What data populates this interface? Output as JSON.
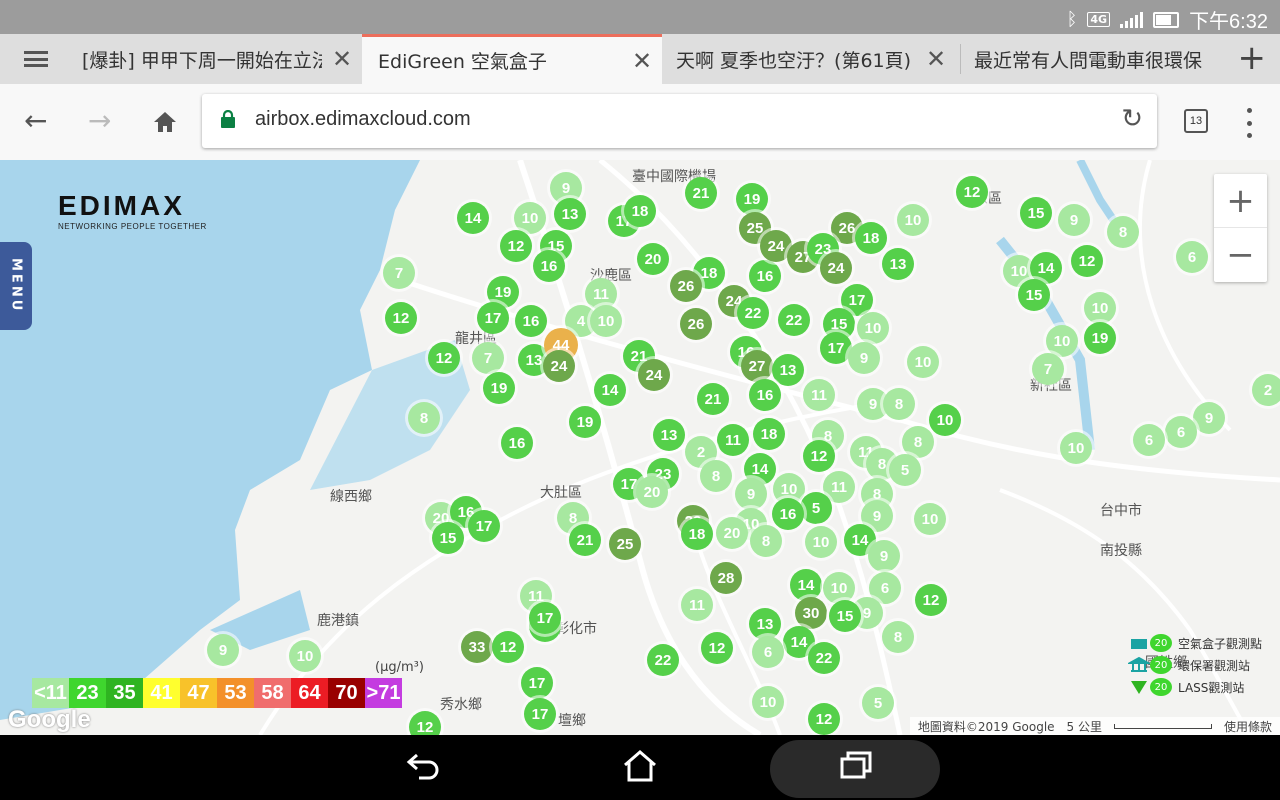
{
  "status": {
    "network": "4G",
    "time": "下午6:32"
  },
  "tabs": [
    {
      "title": "[爆卦] 甲甲下周一開始在立法",
      "active": false
    },
    {
      "title": "EdiGreen 空氣盒子",
      "active": true
    },
    {
      "title": "天啊 夏季也空汙？(第61頁)",
      "active": false
    },
    {
      "title": "最近常有人問電動車很環保",
      "active": false
    }
  ],
  "toolbar": {
    "url": "airbox.edimaxcloud.com",
    "tab_count": "13"
  },
  "map": {
    "brand": {
      "wordmark": "EDIMAX",
      "tagline": "NETWORKING PEOPLE TOGETHER"
    },
    "menu_label": "MENU",
    "zoom_in": "+",
    "zoom_out": "−",
    "places": [
      "臺中國際機場",
      "沙鹿區",
      "龍井區",
      "大肚區",
      "線西鄉",
      "鹿港鎮",
      "彰化市",
      "秀水鄉",
      "壇鄉",
      "南投縣",
      "台中市",
      "國姓鄉",
      "豐原區",
      "新社區"
    ],
    "legend": {
      "unit": "(μg/m³)",
      "bins": [
        {
          "label": "<11",
          "color": "#a7e8a0"
        },
        {
          "label": "23",
          "color": "#3fd62e"
        },
        {
          "label": "35",
          "color": "#2fb421"
        },
        {
          "label": "41",
          "color": "#ffff2e"
        },
        {
          "label": "47",
          "color": "#f8c22a"
        },
        {
          "label": "53",
          "color": "#f3902a"
        },
        {
          "label": "58",
          "color": "#f06d6d"
        },
        {
          "label": "64",
          "color": "#ec1c24"
        },
        {
          "label": "70",
          "color": "#990000"
        },
        {
          "label": ">71",
          "color": "#c43ce0"
        }
      ]
    },
    "station_legend": {
      "value": "20",
      "items": [
        "空氣盒子觀測點",
        "環保署觀測站",
        "LASS觀測站"
      ]
    },
    "google": "Google",
    "attribution": "地圖資料©2019 Google",
    "scale": "5 公里",
    "terms": "使用條款"
  }
}
